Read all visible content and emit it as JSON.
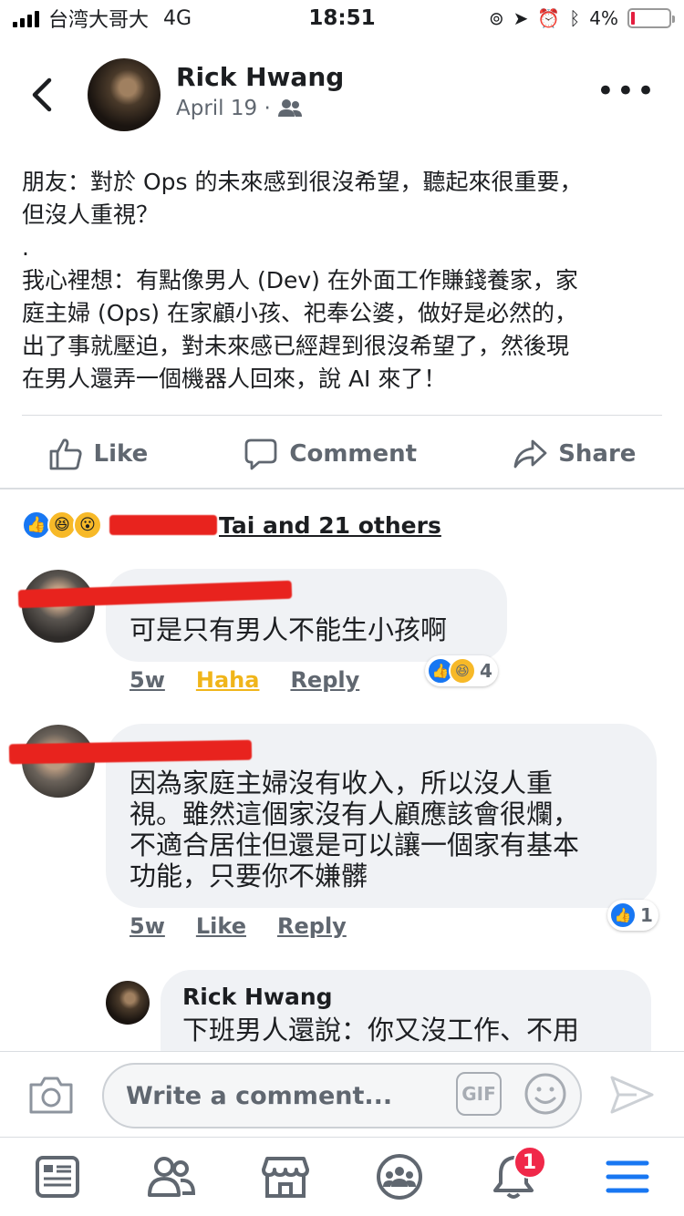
{
  "status_bar": {
    "carrier": "台湾大哥大",
    "network": "4G",
    "time": "18:51",
    "battery_percent": "4%"
  },
  "post": {
    "author": "Rick Hwang",
    "date": "April 19 ·",
    "text_lines": [
      "朋友：對於 Ops 的未來感到很沒希望，聽起來很重要，",
      "但沒人重視？",
      ".",
      "我心裡想：有點像男人 (Dev) 在外面工作賺錢養家，家",
      "庭主婦 (Ops) 在家顧小孩、祀奉公婆，做好是必然的，",
      "出了事就壓迫，對未來感已經趕到很沒希望了，然後現",
      "在男人還弄一個機器人回來，說 AI 來了！"
    ]
  },
  "actions": {
    "like": "Like",
    "comment": "Comment",
    "share": "Share"
  },
  "reactions": {
    "summary_text": "Tai and 21 others"
  },
  "comments": [
    {
      "text": "可是只有男人不能生小孩啊",
      "time": "5w",
      "reaction_label": "Haha",
      "reply": "Reply",
      "reaction_count": "4"
    },
    {
      "text_lines": [
        "因為家庭主婦沒有收入，所以沒人重",
        "視。雖然這個家沒有人顧應該會很爛，",
        "不適合居住但還是可以讓一個家有基本",
        "功能，只要你不嫌髒"
      ],
      "time": "5w",
      "like": "Like",
      "reply": "Reply",
      "reaction_count": "1"
    },
    {
      "author": "Rick Hwang",
      "text": "下班男人還說：你又沒工作、不用"
    }
  ],
  "composer": {
    "placeholder": "Write a comment...",
    "gif": "GIF"
  },
  "nav": {
    "notification_count": "1"
  },
  "colors": {
    "facebook_blue": "#1877f2",
    "haha_yellow": "#f0b51a",
    "badge_red": "#f02849",
    "secondary_text": "#606770"
  }
}
